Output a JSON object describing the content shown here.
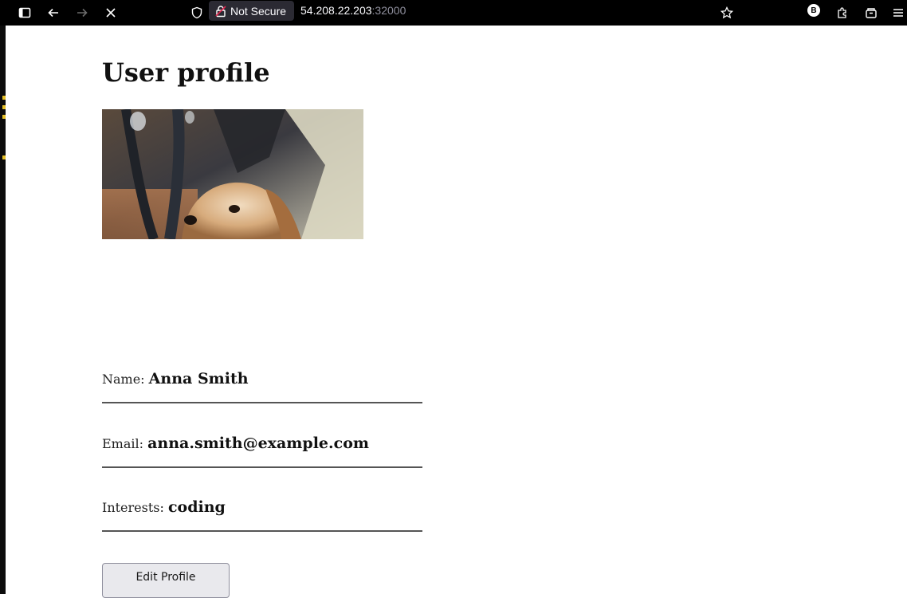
{
  "browser": {
    "security_label": "Not Secure",
    "url_host": "54.208.22.203",
    "url_port": ":32000",
    "extension_badge": "B"
  },
  "page": {
    "title": "User profile",
    "photo_alt": "dog photo"
  },
  "profile": {
    "name_label": "Name: ",
    "name_value": "Anna Smith",
    "email_label": "Email: ",
    "email_value": "anna.smith@example.com",
    "interests_label": "Interests: ",
    "interests_value": "coding"
  },
  "actions": {
    "edit_label": "Edit Profile"
  },
  "colors": {
    "toolbar_bg": "#000000",
    "chip_bg": "#2b2a33",
    "button_bg": "#e9e9ed"
  }
}
